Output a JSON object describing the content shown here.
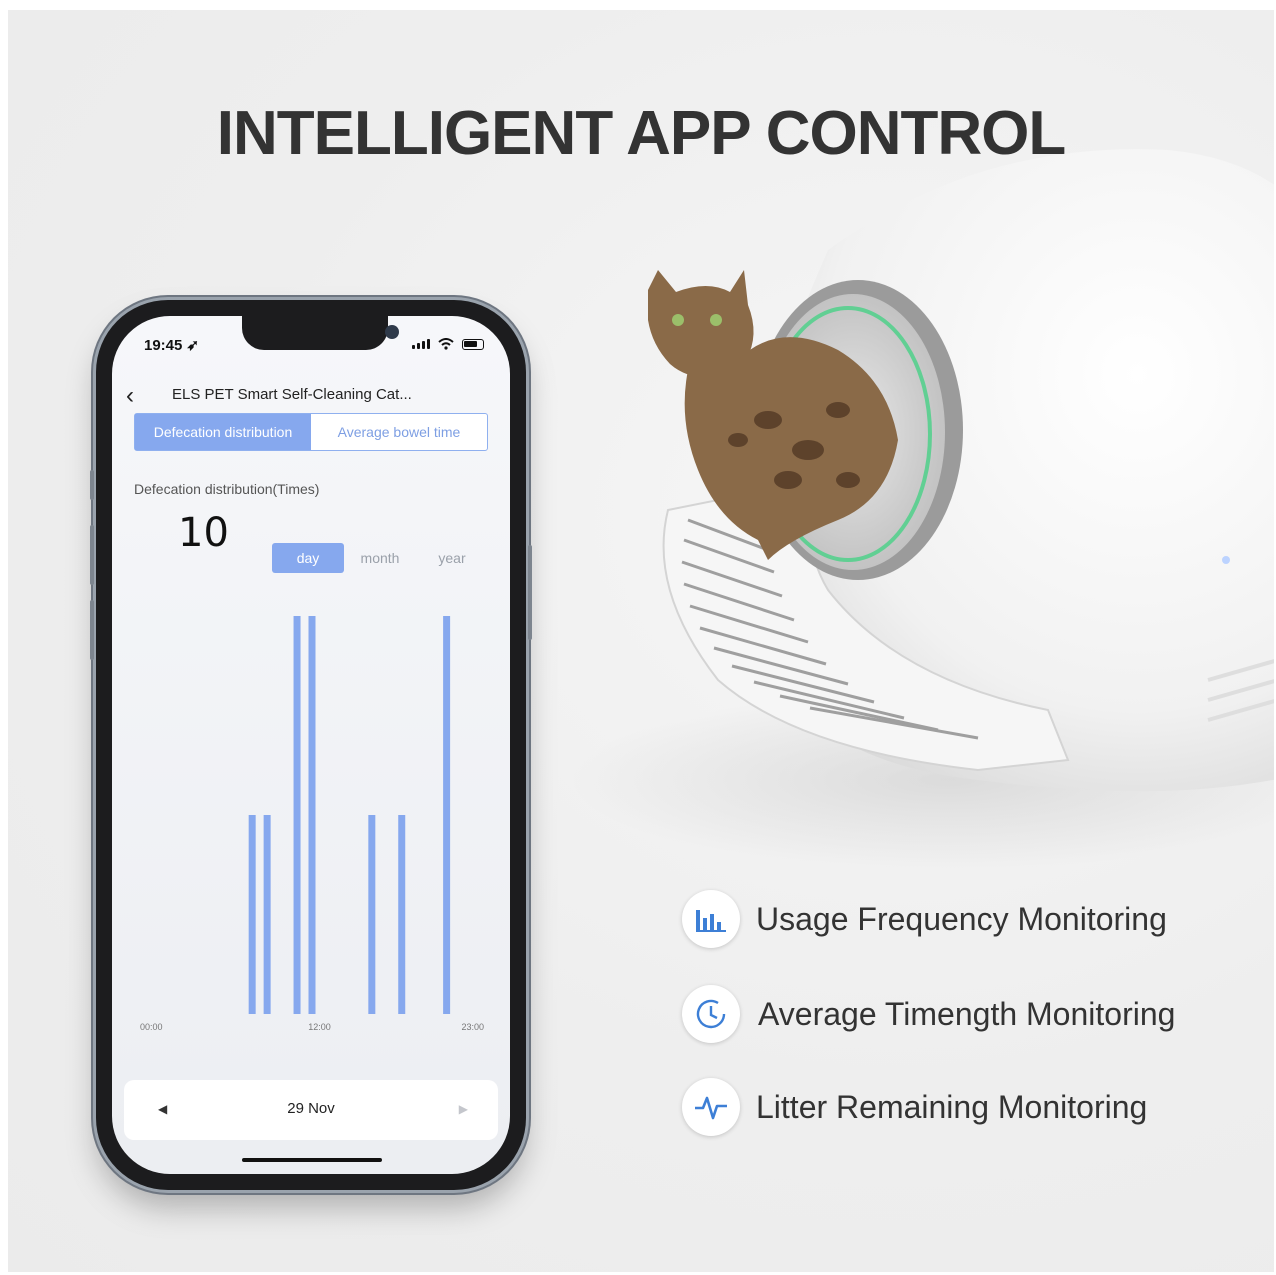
{
  "headline": "INTELLIGENT APP CONTROL",
  "phone": {
    "status_time": "19:45",
    "nav_title": "ELS PET Smart Self-Cleaning Cat...",
    "tabs": [
      {
        "label": "Defecation distribution",
        "active": true
      },
      {
        "label": "Average bowel time",
        "active": false
      }
    ],
    "metric_label": "Defecation distribution(Times)",
    "metric_value": "10",
    "ranges": [
      {
        "label": "day",
        "active": true
      },
      {
        "label": "month",
        "active": false
      },
      {
        "label": "year",
        "active": false
      }
    ],
    "date": "29 Nov"
  },
  "chart_data": {
    "type": "bar",
    "title": "",
    "xlabel": "",
    "ylabel": "",
    "x_ticks": [
      "00:00",
      "12:00",
      "23:00"
    ],
    "xlim": [
      0,
      23
    ],
    "ylim": [
      0,
      2
    ],
    "bars": [
      {
        "x": 7.5,
        "value": 1
      },
      {
        "x": 8.5,
        "value": 1
      },
      {
        "x": 10.5,
        "value": 2
      },
      {
        "x": 11.5,
        "value": 2
      },
      {
        "x": 15.5,
        "value": 1
      },
      {
        "x": 17.5,
        "value": 1
      },
      {
        "x": 20.5,
        "value": 2
      }
    ],
    "bar_color": "#86a8ee",
    "grid": false
  },
  "features": [
    {
      "icon": "bar-chart-icon",
      "label": "Usage Frequency Monitoring"
    },
    {
      "icon": "clock-icon",
      "label": "Average Timength Monitoring"
    },
    {
      "icon": "pulse-icon",
      "label": "Litter Remaining Monitoring"
    }
  ],
  "colors": {
    "accent": "#86a8ee",
    "icon_blue": "#3d7fd6",
    "text_dark": "#333333"
  }
}
